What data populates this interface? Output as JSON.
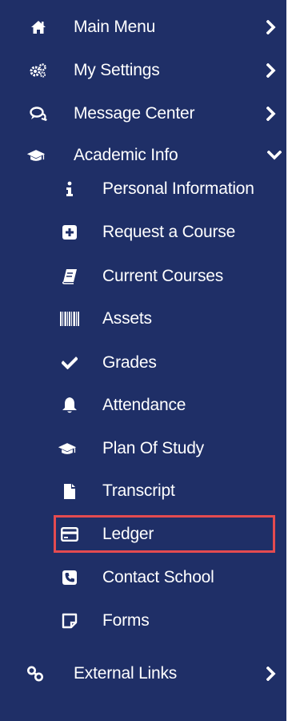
{
  "colors": {
    "sidebar_bg": "#1f2f67",
    "text": "#ffffff",
    "highlight_border": "#e44b50"
  },
  "menu": {
    "items": [
      {
        "label": "Main Menu",
        "icon": "home-icon",
        "chevron": "chevron-right-icon"
      },
      {
        "label": "My Settings",
        "icon": "cogs-icon",
        "chevron": "chevron-right-icon"
      },
      {
        "label": "Message Center",
        "icon": "comments-icon",
        "chevron": "chevron-right-icon"
      },
      {
        "label": "Academic Info",
        "icon": "graduation-cap-icon",
        "chevron": "chevron-down-icon",
        "expanded": true,
        "children": [
          {
            "label": "Personal Information",
            "icon": "info-icon"
          },
          {
            "label": "Request a Course",
            "icon": "plus-square-icon"
          },
          {
            "label": "Current Courses",
            "icon": "book-icon"
          },
          {
            "label": "Assets",
            "icon": "barcode-icon"
          },
          {
            "label": "Grades",
            "icon": "check-icon"
          },
          {
            "label": "Attendance",
            "icon": "bell-icon"
          },
          {
            "label": "Plan Of Study",
            "icon": "graduation-cap-icon"
          },
          {
            "label": "Transcript",
            "icon": "file-icon"
          },
          {
            "label": "Ledger",
            "icon": "credit-card-icon",
            "highlighted": true
          },
          {
            "label": "Contact School",
            "icon": "phone-square-icon"
          },
          {
            "label": "Forms",
            "icon": "sticky-note-icon"
          }
        ]
      },
      {
        "label": "External Links",
        "icon": "link-icon",
        "chevron": "chevron-right-icon"
      }
    ]
  }
}
